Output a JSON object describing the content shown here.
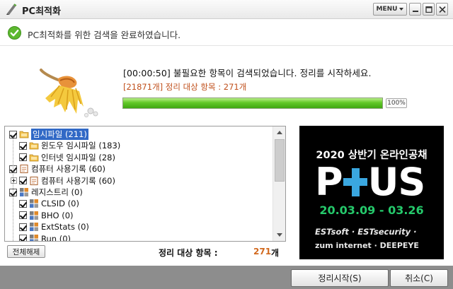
{
  "window": {
    "title": "PC최적화",
    "menu_label": "MENU",
    "icons": {
      "app": "pen-icon",
      "minimize": "minimize-icon",
      "maximize": "maximize-icon",
      "close": "close-icon"
    }
  },
  "status": {
    "icon": "check-circle-icon",
    "text": "PC최적화를 위한 검색을 완료하였습니다."
  },
  "scan": {
    "icon": "broom-icon",
    "message": "[00:00:50]  불필요한 항목이 검색되었습니다. 정리를 시작하세요.",
    "summary": "[21871개] 정리 대상 항목 : 271개",
    "progress_percent": 100,
    "progress_label": "100%"
  },
  "tree": {
    "items": [
      {
        "label": "임시파일 (211)",
        "level": 0,
        "checked": true,
        "icon": "folder-icon",
        "selected": true
      },
      {
        "label": "윈도우 임시파일 (183)",
        "level": 1,
        "checked": true,
        "icon": "folder-icon"
      },
      {
        "label": "인터넷 임시파일 (28)",
        "level": 1,
        "checked": true,
        "icon": "folder-icon"
      },
      {
        "label": "컴퓨터 사용기록 (60)",
        "level": 0,
        "checked": true,
        "icon": "history-icon"
      },
      {
        "label": "컴퓨터 사용기록 (60)",
        "level": 1,
        "checked": true,
        "icon": "history-icon",
        "expander": true
      },
      {
        "label": "레지스트리 (0)",
        "level": 0,
        "checked": true,
        "icon": "registry-icon"
      },
      {
        "label": "CLSID (0)",
        "level": 1,
        "checked": true,
        "icon": "registry-icon"
      },
      {
        "label": "BHO (0)",
        "level": 1,
        "checked": true,
        "icon": "registry-icon"
      },
      {
        "label": "ExtStats (0)",
        "level": 1,
        "checked": true,
        "icon": "registry-icon"
      },
      {
        "label": "Run (0)",
        "level": 1,
        "checked": true,
        "icon": "registry-icon"
      }
    ],
    "deselect_label": "전체해제",
    "total_label": "정리 대상 항목 :",
    "total_value": "271",
    "total_unit": "개"
  },
  "ad": {
    "headline": "2020 상반기 온라인공채",
    "logo_left": "P",
    "logo_right": "US",
    "dates": "20.03.09 - 03.26",
    "brands_line1": "ESTsoft · ESTsecurity ·",
    "brands_line2": "zum internet · DEEPEYE"
  },
  "footer": {
    "start_label": "정리시작(S)",
    "cancel_label": "취소(C)"
  },
  "colors": {
    "progress": "#4fbb1c",
    "summary_text": "#c0501c",
    "selection": "#3169c6",
    "ad_accent_blue": "#3aa7e0",
    "ad_accent_green": "#25c96b",
    "footer_bg": "#8d8d8d"
  }
}
